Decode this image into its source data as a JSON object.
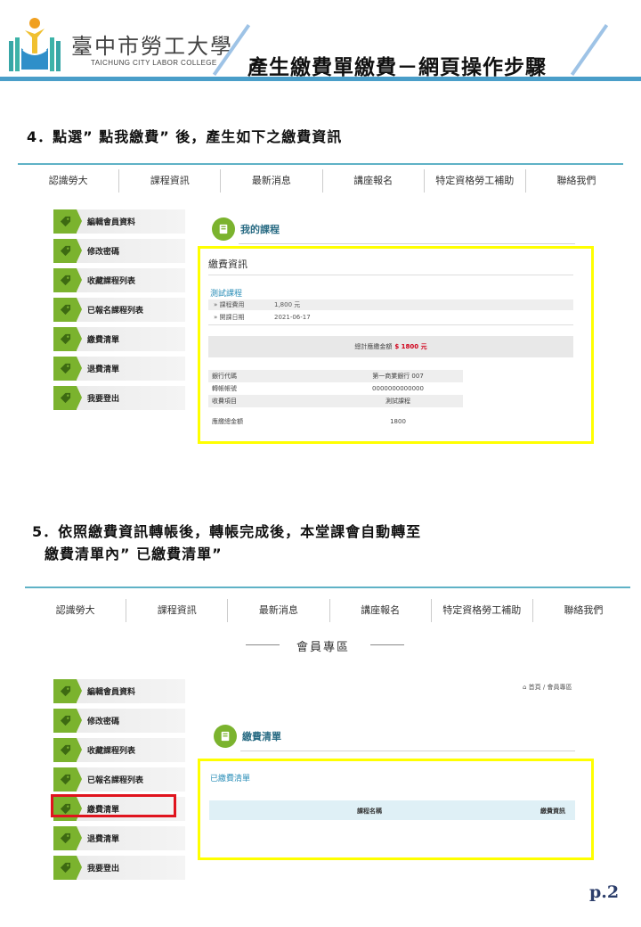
{
  "header": {
    "school_name": "臺中市勞工大學",
    "school_name_en": "TAICHUNG CITY LABOR COLLEGE",
    "title": "產生繳費單繳費－網頁操作步驟",
    "accent_color": "#4a9ec9"
  },
  "step4": {
    "heading": "4．點選” 點我繳費” 後，產生如下之繳費資訊"
  },
  "step5": {
    "heading_line1": "5．依照繳費資訊轉帳後，轉帳完成後，本堂課會自動轉至",
    "heading_line2": "繳費清單內” 已繳費清單”"
  },
  "nav": {
    "items": [
      "認識勞大",
      "課程資訊",
      "最新消息",
      "講座報名",
      "特定資格勞工補助",
      "聯絡我們"
    ]
  },
  "sidebar": {
    "items": [
      "編輯會員資料",
      "修改密碼",
      "收藏課程列表",
      "已報名課程列表",
      "繳費清單",
      "退費清單",
      "我要登出"
    ]
  },
  "screen1": {
    "section_title": "我的課程",
    "card_title": "繳費資訊",
    "course_link": "測試課程",
    "rows": [
      {
        "key": "» 課程費用",
        "value": "1,800 元"
      },
      {
        "key": "» 開課日期",
        "value": "2021-06-17"
      }
    ],
    "total_label": "總計應繳金額",
    "total_amount": "$ 1800 元",
    "bank_rows": [
      {
        "key": "銀行代碼",
        "value": "第一商業銀行 007"
      },
      {
        "key": "轉帳帳號",
        "value": "0000000000000"
      },
      {
        "key": "收費項目",
        "value": "測試課程"
      },
      {
        "key": "應繳總金額",
        "value": "1800"
      }
    ]
  },
  "screen2": {
    "member_area_title": "會員專區",
    "breadcrumb": "首頁 / 會員專區",
    "section_title": "繳費清單",
    "paid_list_label": "已繳費清單",
    "col_course_name": "課程名稱",
    "col_payment_info": "繳費資訊"
  },
  "page_number": "p.2",
  "colors": {
    "highlight_yellow": "#ffff00",
    "highlight_red": "#e0141e",
    "side_green": "#7bb32e",
    "amount_red": "#d0021b"
  }
}
